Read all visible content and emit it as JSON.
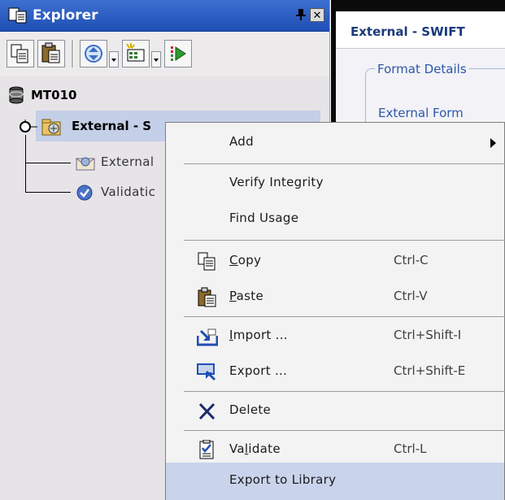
{
  "explorer": {
    "title": "Explorer",
    "tree": {
      "root_label": "MT010",
      "selected_label": "External - S",
      "selected_suffix": "...",
      "child1_label": "External",
      "child2_label": "Validatic"
    }
  },
  "document": {
    "tab_title": "External - SWIFT",
    "group_label": "Format Details",
    "field_label": "External Form"
  },
  "context_menu": {
    "items": [
      {
        "label": "Add",
        "shortcut": "",
        "icon": ""
      },
      {
        "label": "Verify Integrity",
        "shortcut": "",
        "icon": ""
      },
      {
        "label": "Find Usage",
        "shortcut": "",
        "icon": ""
      },
      {
        "label_pre": "",
        "label_ul": "C",
        "label_post": "opy",
        "shortcut": "Ctrl-C",
        "icon": "copy-icon"
      },
      {
        "label_pre": "",
        "label_ul": "P",
        "label_post": "aste",
        "shortcut": "Ctrl-V",
        "icon": "paste-icon"
      },
      {
        "label_pre": "",
        "label_ul": "I",
        "label_post": "mport ...",
        "shortcut": "Ctrl+Shift-I",
        "icon": "import-icon"
      },
      {
        "label_pre": "Export ...",
        "shortcut": "Ctrl+Shift-E",
        "icon": "export-icon"
      },
      {
        "label_pre": "Delete",
        "shortcut": "",
        "icon": "delete-icon"
      },
      {
        "label_pre": "Va",
        "label_ul": "l",
        "label_post": "idate",
        "shortcut": "Ctrl-L",
        "icon": "validate-icon"
      },
      {
        "label": "Export to Library",
        "shortcut": "",
        "icon": "",
        "highlighted": true
      }
    ]
  },
  "colors": {
    "title_bar": "#2b5cc4",
    "menu_highlight": "#c9d4ec",
    "selection": "#c4cfe8"
  }
}
